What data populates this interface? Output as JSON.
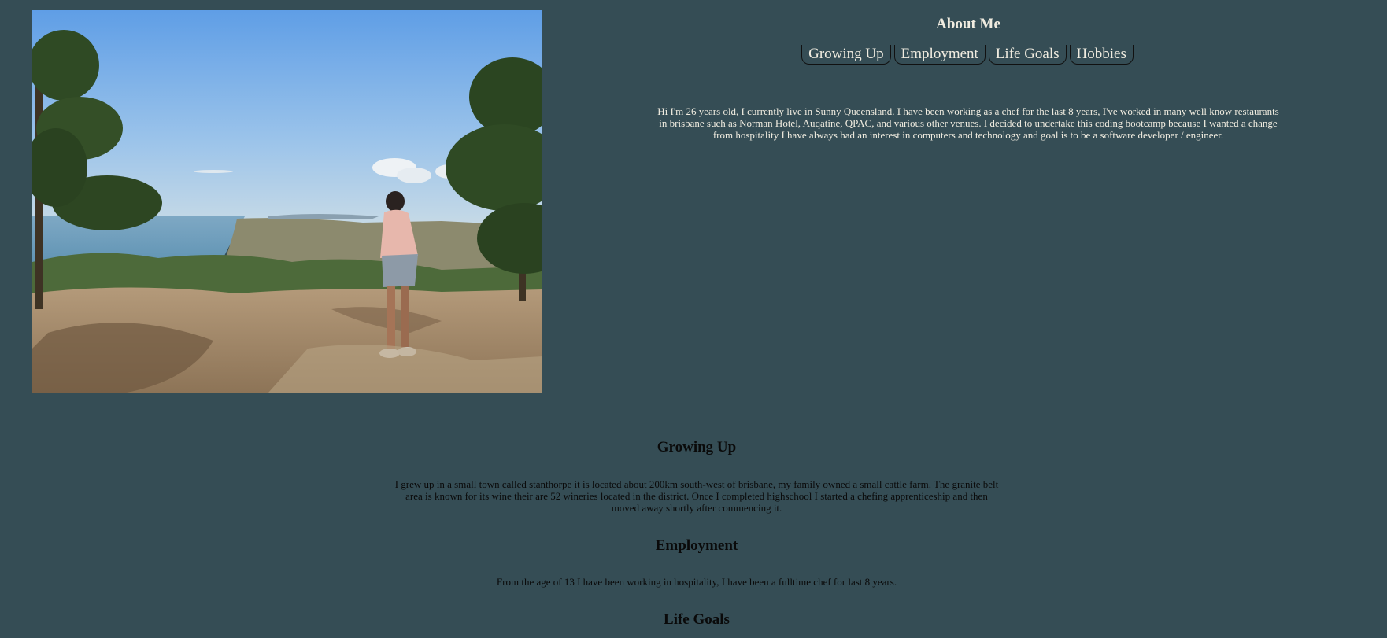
{
  "about": {
    "heading": "About Me",
    "tabs": [
      "Growing Up",
      "Employment",
      "Life Goals",
      "Hobbies"
    ],
    "text": "Hi I'm 26 years old, I currently live in Sunny Queensland. I have been working as a chef for the last 8 years, I've worked in many well know restaurants in brisbane such as Norman Hotel, Auqatine, QPAC, and various other venues. I decided to undertake this coding bootcamp because I wanted a change from hospitality I have always had an interest in computers and technology and goal is to be a software developer / engineer."
  },
  "sections": {
    "growing_up": {
      "heading": "Growing Up",
      "text": "I grew up in a small town called stanthorpe it is located about 200km south-west of brisbane, my family owned a small cattle farm. The granite belt area is known for its wine their are 52 wineries located in the district. Once I completed highschool I started a chefing apprenticeship and then moved away shortly after commencing it."
    },
    "employment": {
      "heading": "Employment",
      "text": "From the age of 13 I have been working in hospitality, I have been a fulltime chef for last 8 years."
    },
    "life_goals": {
      "heading": "Life Goals"
    }
  },
  "colors": {
    "background": "#354d55",
    "light_text": "#f0ece0",
    "dark_text": "#0a0a0a"
  }
}
